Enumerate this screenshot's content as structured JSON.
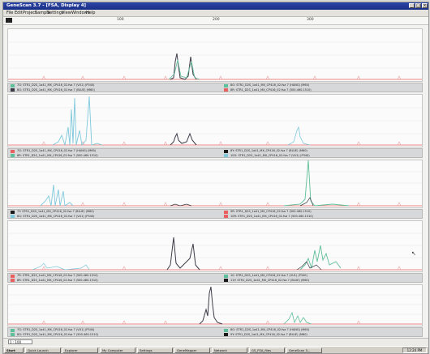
{
  "window": {
    "title": "GeneScan 3.7 - [FSA, Display 4]"
  },
  "menu": [
    "File",
    "Edit",
    "Project",
    "Sample",
    "Settings",
    "View",
    "Windows",
    "Help"
  ],
  "ruler_ticks": [
    "100",
    "200",
    "300"
  ],
  "colors": {
    "blue": "#3c3c48",
    "green": "#5fbf9a",
    "cyan": "#7fc8dc",
    "red": "#e86060"
  },
  "panels": [
    {
      "legend_left": [
        "7G: STR1_D2S_1a41_MX_CP416_02.fsa 7 (VU1) (P340)",
        "8G: STR1_D2S_1a41_MX_CP416_02.fsa 7 (BLUE) (M60)"
      ],
      "legend_right": [
        "8G: STR1_D2S_1a41_MX_CP416_02.fsa 7 (HANG) (M60)",
        "8R: STR1_D2S_1a41_MX_CP416_02.fsa 7 (500.460.1510)"
      ]
    },
    {
      "legend_left": [
        "7G: STR1_D2S_1a41_MX_CP416_02.fsa 7 (HANG) (M60)",
        "8R: STR1_D2S_1a41_MX_CP416_02.fsa 7 (500.460.1510)"
      ],
      "legend_right": [
        "8Y: STR1_D2S_1a41_MX_CP416_02.fsa 7 (BLUE) (M60)",
        "10G: STR1_D2S_1a41_MX_CP416_02.fsa 7 (VU1) (P340)"
      ]
    },
    {
      "legend_left": [
        "7Y: STR1_D2S_1a41_MX_CP416_02.fsa 7 (BLUE) (M60)",
        "8G: STR1_D2S_1a41_MX_CP416_02.fsa 7 (VU1) (P340)"
      ],
      "legend_right": [
        "9R: STR1_D2S_1a41_MX_CP416_02.fsa 7 (500.460.1510)",
        "10R: STR1_D2S_1a41_MX_CP416_02.fsa 7 (500.460.1510)"
      ]
    },
    {
      "legend_left": [
        "7R: STR1_D2S_1a41_MX_CP416_02.fsa 7 (500.460.1510)",
        "8R: STR1_D2S_1a41_MX_CP416_02.fsa 7 (500.460.1510)"
      ],
      "legend_right": [
        "10: STR1_D2S_1a41_MX_CP416_02.fsa 7 (VU1) (P340)",
        "11Y: STR1_D2S_1a41_MX_CP416_02.fsa 7 (BLUE) (M60)"
      ]
    },
    {
      "legend_left": [
        "7G: STR1_D2S_1a41_MX_CP416_02.fsa 7 (VU1) (P340)",
        "8G: STR1_D2S_1a41_MX_CP416_02.fsa 7 (500.460.1510)"
      ],
      "legend_right": [
        "8G: STR1_D2S_1a41_MX_CP416_02.fsa 7 (HANG) (M60)",
        "9Y: STR1_D2S_1a41_MX_CP416_02.fsa 7 (BLUE) (M60)"
      ]
    }
  ],
  "status": {
    "zoom": "1 : 100"
  },
  "taskbar": {
    "start": "Start",
    "items": [
      "Quick Launch",
      "Explorer",
      "My Computer",
      "Settings",
      "GeneMapper",
      "Network",
      "GS_FSA_files",
      "GeneScan 3..."
    ],
    "clock": "12:24 PM"
  }
}
